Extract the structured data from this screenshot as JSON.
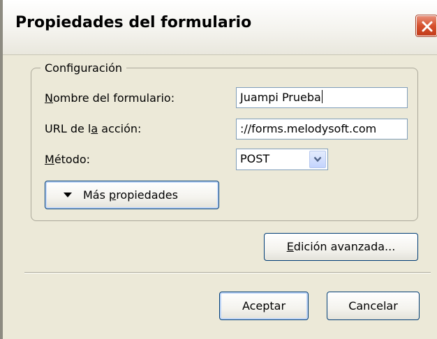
{
  "window": {
    "title": "Propiedades del formulario",
    "close_icon": "close-icon"
  },
  "group": {
    "legend": "Configuración"
  },
  "form": {
    "name": {
      "label_pre": "",
      "label_key": "N",
      "label_post": "ombre del formulario:",
      "value": "Juampi Prueba"
    },
    "action": {
      "label_pre": "URL de l",
      "label_key": "a",
      "label_post": " acción:",
      "value": "://forms.melodysoft.com"
    },
    "method": {
      "label_pre": "",
      "label_key": "M",
      "label_post": "étodo:",
      "value": "POST",
      "arrow_icon": "chevron-down-icon"
    },
    "more": {
      "label_pre": "Más ",
      "label_key": "p",
      "label_post": "ropiedades",
      "icon": "triangle-down-icon"
    }
  },
  "buttons": {
    "advanced": {
      "pre": "",
      "key": "E",
      "post": "dición avanzada..."
    },
    "ok": "Aceptar",
    "cancel": "Cancelar"
  }
}
